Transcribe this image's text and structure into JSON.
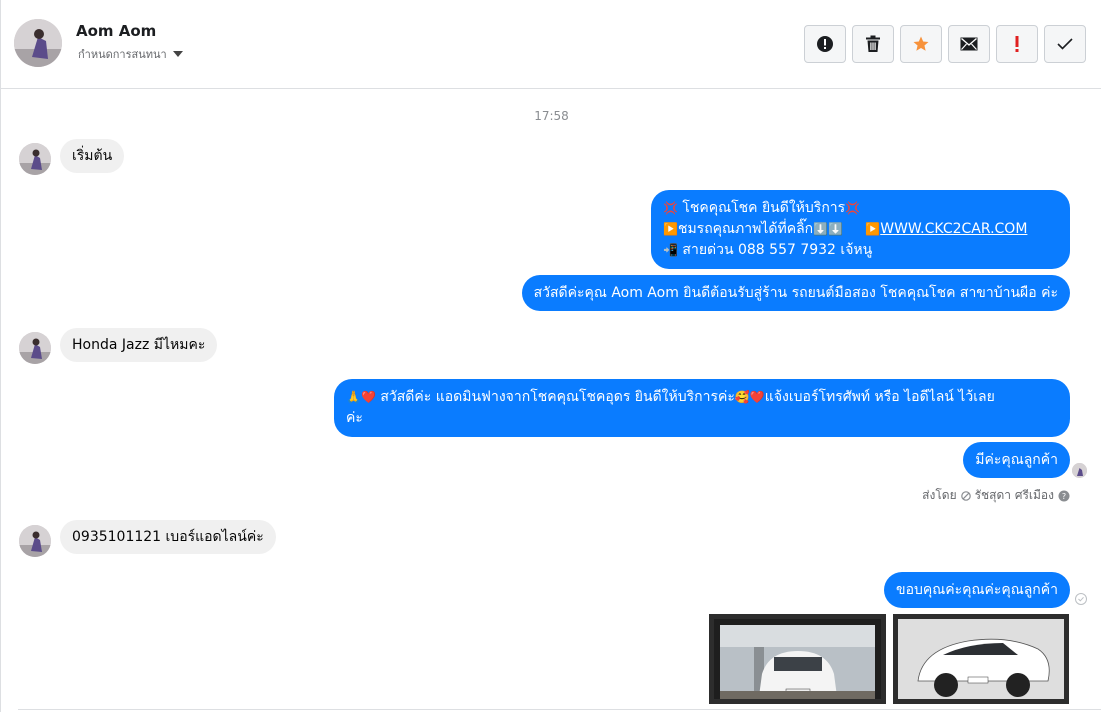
{
  "header": {
    "name": "Aom Aom",
    "subtitle": "กำหนดการสนทนา",
    "actions": [
      "mark-spam",
      "delete",
      "star",
      "mark-unread",
      "important",
      "done"
    ]
  },
  "thread": {
    "timestamp": "17:58",
    "messages": [
      {
        "from": "customer",
        "text": "เริ่มต้น"
      },
      {
        "from": "page",
        "line1": "โชคคุณโชค ยินดีให้บริการ",
        "line2_prefix": "ชมรถคุณภาพได้ที่คลิ๊ก",
        "line2_link": "WWW.CKC2CAR.COM",
        "line3": "สายด่วน 088 557 7932 เจ้หนู"
      },
      {
        "from": "page",
        "text": "สวัสดีค่ะคุณ Aom Aom ยินดีต้อนรับสู่ร้าน รถยนต์มือสอง โชคคุณโชค สาขาบ้านผือ ค่ะ"
      },
      {
        "from": "customer",
        "text": "Honda Jazz มีไหมคะ"
      },
      {
        "from": "page",
        "line1_a": "สวัสดีค่ะ แอดมินฟางจากโชคคุณโชคอุดร ยินดีให้บริการค่ะ",
        "line1_b": "แจ้งเบอร์โทรศัพท์ หรือ ไอดีไลน์  ไว้เลย",
        "line2": "ค่ะ"
      },
      {
        "from": "page",
        "text": "มีค่ะคุณลูกค้า"
      },
      {
        "from": "customer",
        "text": "0935101121 เบอร์แอดไลน์ค่ะ"
      },
      {
        "from": "page",
        "text": "ขอบคุณค่ะคุณค่ะคุณลูกค้า"
      }
    ],
    "sent_by_label": "ส่งโดย",
    "sent_by_name": "รัชสุดา ศรีเมือง"
  },
  "colors": {
    "outgoing": "#0a7cff",
    "incoming": "#f0f0f0",
    "star": "#f7923b",
    "important": "#e02020"
  }
}
